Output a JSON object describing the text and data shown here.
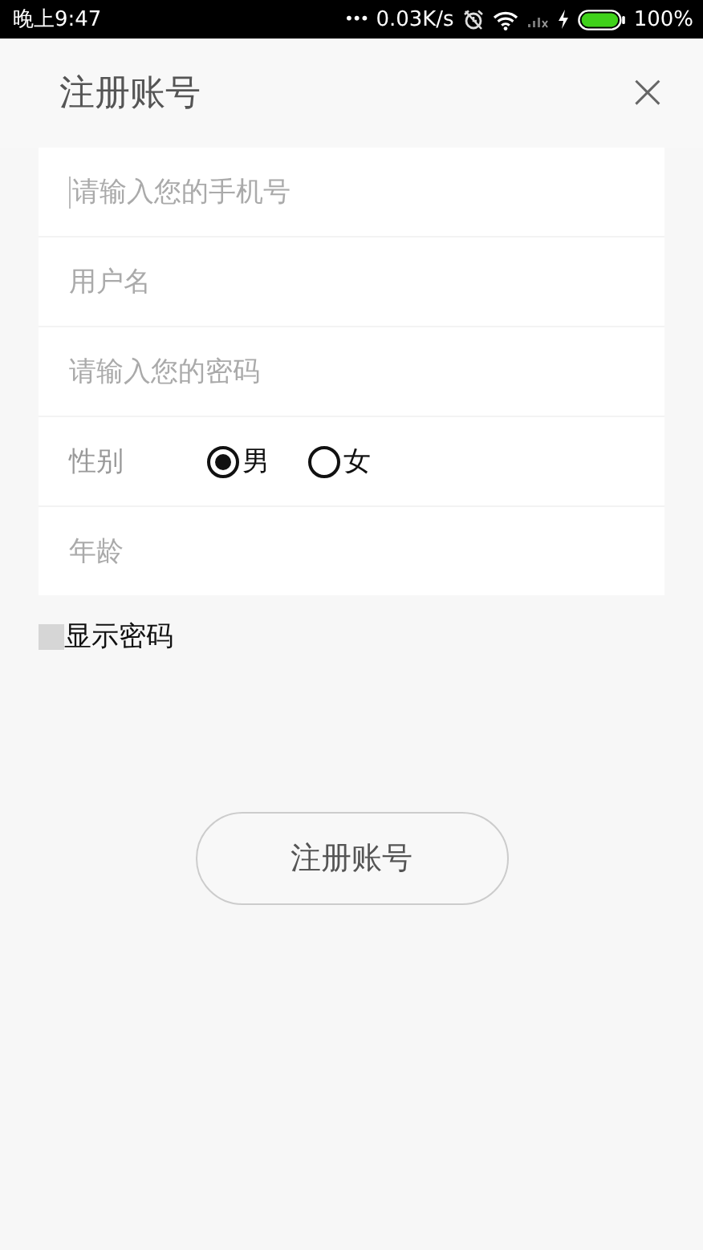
{
  "status_bar": {
    "time": "晚上9:47",
    "dots": "•••",
    "speed": "0.03K/s",
    "battery": "100%"
  },
  "header": {
    "title": "注册账号",
    "close": "×"
  },
  "form": [
    {
      "kind": "input",
      "placeholder": "请输入您的手机号",
      "focused": true
    },
    {
      "kind": "input",
      "placeholder": "用户名",
      "focused": false
    },
    {
      "kind": "input",
      "placeholder": "请输入您的密码",
      "focused": false
    },
    {
      "kind": "radio",
      "label": "性别",
      "options": [
        {
          "label": "男",
          "selected": true
        },
        {
          "label": "女",
          "selected": false
        }
      ]
    },
    {
      "kind": "input",
      "placeholder": "年龄",
      "focused": false
    }
  ],
  "show_password": {
    "label": "显示密码",
    "checked": false
  },
  "submit": "注册账号"
}
